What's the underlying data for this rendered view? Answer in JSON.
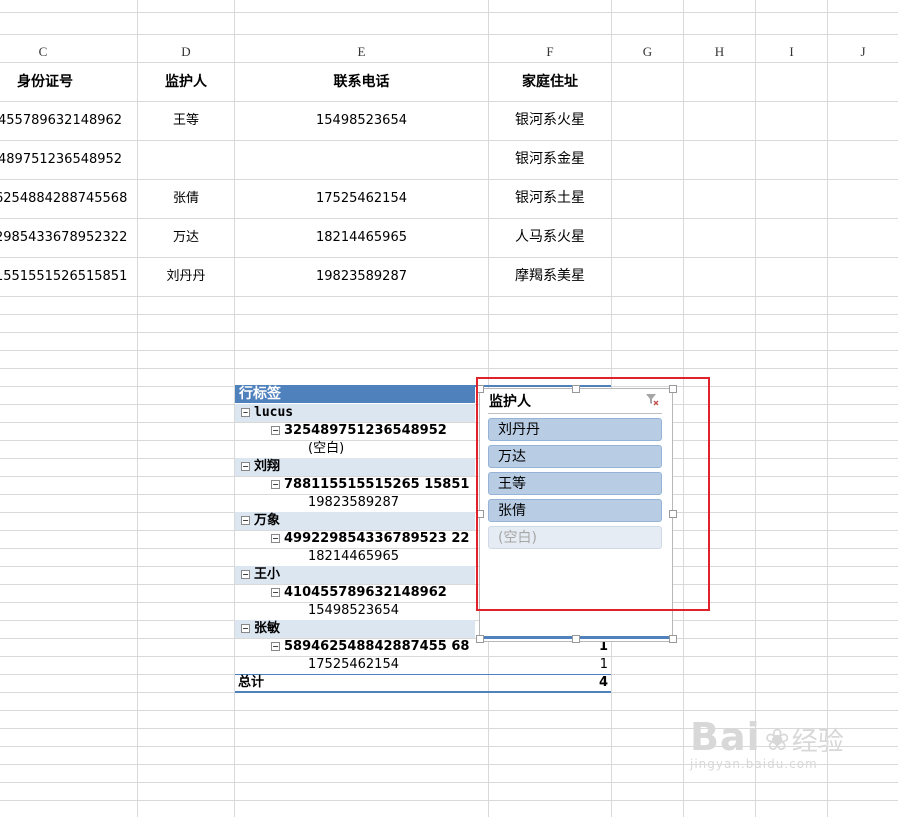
{
  "columns": [
    "C",
    "D",
    "E",
    "F",
    "G",
    "H",
    "I",
    "J"
  ],
  "headers": {
    "id": "身份证号",
    "guardian": "监护人",
    "phone": "联系电话",
    "address": "家庭住址"
  },
  "rows": [
    {
      "id": "455789632148962",
      "guardian": "王等",
      "phone": "15498523654",
      "address": "银河系火星"
    },
    {
      "id": "489751236548952",
      "guardian": "",
      "phone": "",
      "address": "银河系金星"
    },
    {
      "id": "6254884288745568",
      "guardian": "张倩",
      "phone": "17525462154",
      "address": "银河系土星"
    },
    {
      "id": "2985433678952322",
      "guardian": "万达",
      "phone": "18214465965",
      "address": "人马系火星"
    },
    {
      "id": "1551551526515851",
      "guardian": "刘丹丹",
      "phone": "19823589287",
      "address": "摩羯系美星"
    }
  ],
  "pivot": {
    "row_label": "行标签",
    "groups": [
      {
        "name": "lucus",
        "id": "325489751236548952",
        "phone": "(空白)"
      },
      {
        "name": "刘翔",
        "id": "788115515515265 15851",
        "phone": "19823589287"
      },
      {
        "name": "万象",
        "id": "499229854336789523 22",
        "phone": "18214465965"
      },
      {
        "name": "王小",
        "id": "410455789632148962",
        "phone": "15498523654"
      },
      {
        "name": "张敏",
        "id": "589462548842887455 68",
        "phone": "17525462154",
        "count": "1",
        "phone_count": "1"
      }
    ],
    "total_label": "总计",
    "total_value": "4"
  },
  "slicer": {
    "title": "监护人",
    "items": [
      "刘丹丹",
      "万达",
      "王等",
      "张倩"
    ],
    "empty_item": "(空白)"
  },
  "watermark": {
    "brand": "Bai",
    "brand2": "经验",
    "url": "jingyan.baidu.com"
  },
  "colors": {
    "pivot_header": "#4f81bd",
    "pivot_band": "#dce6f1",
    "slicer_item": "#b8cce4",
    "highlight_box": "#e0222b"
  }
}
